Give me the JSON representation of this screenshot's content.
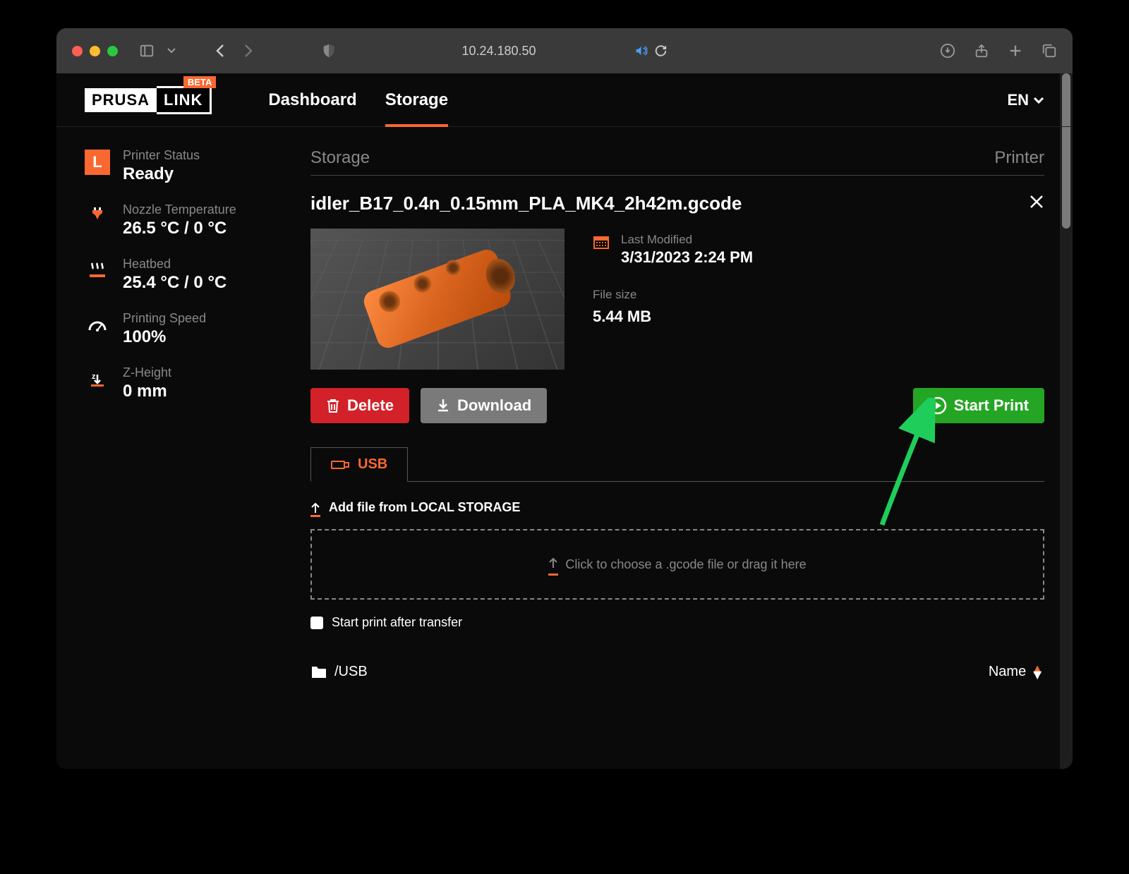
{
  "browser": {
    "address": "10.24.180.50"
  },
  "logo": {
    "part1": "PRUSA",
    "part2": "LINK",
    "badge": "BETA"
  },
  "nav": {
    "dashboard": "Dashboard",
    "storage": "Storage",
    "lang": "EN"
  },
  "sidebar": {
    "status_label": "Printer Status",
    "status_value": "Ready",
    "nozzle_label": "Nozzle Temperature",
    "nozzle_value": "26.5 °C / 0 °C",
    "bed_label": "Heatbed",
    "bed_value": "25.4 °C / 0 °C",
    "speed_label": "Printing Speed",
    "speed_value": "100%",
    "z_label": "Z-Height",
    "z_value": "0 mm",
    "status_letter": "L"
  },
  "main": {
    "heading_left": "Storage",
    "heading_right": "Printer",
    "file_name": "idler_B17_0.4n_0.15mm_PLA_MK4_2h42m.gcode",
    "modified_label": "Last Modified",
    "modified_value": "3/31/2023 2:24 PM",
    "size_label": "File size",
    "size_value": "5.44 MB",
    "btn_delete": "Delete",
    "btn_download": "Download",
    "btn_start": "Start Print",
    "tab_usb": "USB",
    "add_file": "Add file from LOCAL STORAGE",
    "dropzone": "Click to choose a .gcode file or drag it here",
    "checkbox_label": "Start print after transfer",
    "path": "/USB",
    "sort_label": "Name"
  }
}
